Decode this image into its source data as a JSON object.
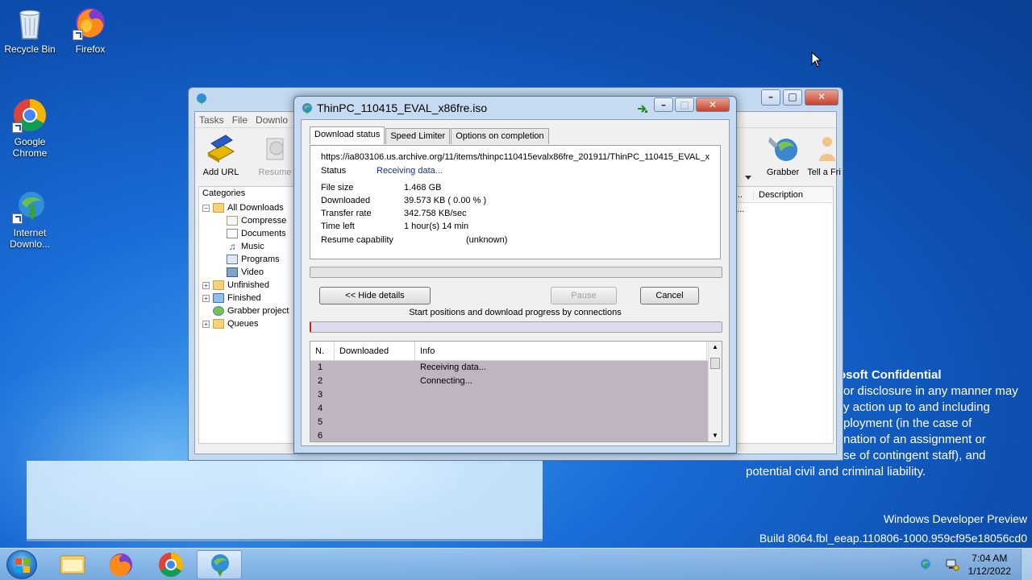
{
  "desktop": {
    "icons": [
      {
        "label": "Recycle Bin"
      },
      {
        "label": "Firefox"
      },
      {
        "label": "Google Chrome"
      },
      {
        "label": "Internet Downlo..."
      }
    ],
    "watermark_title": "osoft Confidential",
    "watermark_lines": [
      "or disclosure in any manner may",
      "y action up to and including",
      "ployment (in the case of",
      "nation of an assignment or",
      "se of contingent staff), and",
      "potential civil and criminal liability."
    ],
    "build_title": "Windows Developer Preview",
    "build_line": "Build 8064.fbl_eeap.110806-1000.959cf95e18056cd0"
  },
  "idm_main": {
    "menu": [
      "Tasks",
      "File",
      "Downlo"
    ],
    "toolbar": {
      "add_url": "Add URL",
      "resume": "Resume",
      "grabber": "Grabber",
      "tell_friend": "Tell a Fri"
    },
    "categories_title": "Categories",
    "categories": [
      "All Downloads",
      "Compresse",
      "Documents",
      "Music",
      "Programs",
      "Video",
      "Unfinished",
      "Finished",
      "Grabber project",
      "Queues"
    ],
    "list_columns": [
      "y...",
      "Description"
    ],
    "list_cell": "0..."
  },
  "dialog": {
    "title": "ThinPC_110415_EVAL_x86fre.iso",
    "tabs": [
      "Download status",
      "Speed Limiter",
      "Options on completion"
    ],
    "url": "https://ia803106.us.archive.org/11/items/thinpc110415evalx86fre_201911/ThinPC_110415_EVAL_x",
    "status_label": "Status",
    "status_value": "Receiving data...",
    "fields": [
      {
        "label": "File size",
        "value": "1.468  GB"
      },
      {
        "label": "Downloaded",
        "value": "39.573  KB  ( 0.00 % )"
      },
      {
        "label": "Transfer rate",
        "value": "342.758  KB/sec"
      },
      {
        "label": "Time left",
        "value": "1 hour(s)  14 min"
      },
      {
        "label": "Resume capability",
        "value": "(unknown)"
      }
    ],
    "buttons": {
      "hide_details": "<< Hide details",
      "pause": "Pause",
      "cancel": "Cancel"
    },
    "connections_label": "Start positions and download progress by connections",
    "table_columns": [
      "N.",
      "Downloaded",
      "Info"
    ],
    "rows": [
      {
        "n": "1",
        "info": "Receiving data..."
      },
      {
        "n": "2",
        "info": "Connecting..."
      },
      {
        "n": "3",
        "info": ""
      },
      {
        "n": "4",
        "info": ""
      },
      {
        "n": "5",
        "info": ""
      },
      {
        "n": "6",
        "info": ""
      }
    ],
    "progress_fraction": 0.0
  },
  "taskbar": {
    "time": "7:04 AM",
    "date": "1/12/2022"
  },
  "colors": {
    "status_blue": "#0b2fa8",
    "connection_rows_bg": "#c0b4c0",
    "progress_red": "#c81e1e"
  }
}
